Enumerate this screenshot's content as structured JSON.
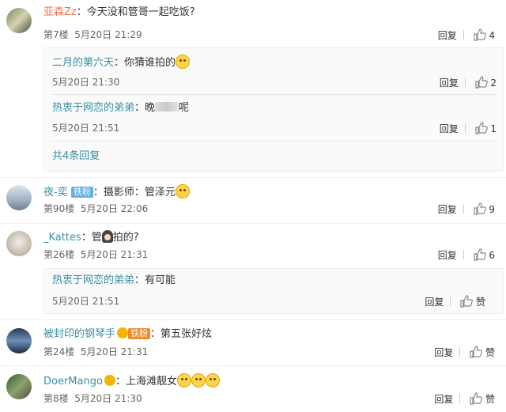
{
  "comments": [
    {
      "user": "亚森Zz",
      "text": "：今天没和管哥一起吃饭?",
      "floor": "第7楼",
      "time": "5月20日 21:29",
      "reply_label": "回复",
      "likes": "4",
      "replies": [
        {
          "user": "二月的第六天",
          "text": "：你猜谁拍的",
          "time": "5月20日 21:30",
          "reply_label": "回复",
          "likes": "2"
        },
        {
          "user": "热衷于网恋的弟弟",
          "text_a": "：晚",
          "text_b": "呢",
          "time": "5月20日 21:51",
          "reply_label": "回复",
          "likes": "1"
        }
      ],
      "more_replies": "共4条回复"
    },
    {
      "user": "夜-奕",
      "badge": "铁粉",
      "text": "：摄影师：管泽元",
      "floor": "第90楼",
      "time": "5月20日 22:06",
      "reply_label": "回复",
      "likes": "9"
    },
    {
      "user": "_Kattes",
      "text_a": "：管",
      "text_b": "拍的?",
      "floor": "第26楼",
      "time": "5月20日 21:31",
      "reply_label": "回复",
      "likes": "6",
      "replies": [
        {
          "user": "热衷于网恋的弟弟",
          "text": "：有可能",
          "time": "5月20日 21:51",
          "reply_label": "回复",
          "likes": "赞"
        }
      ]
    },
    {
      "user": "被封印的钢琴手",
      "badge": "铁粉",
      "text": "：第五张好炫",
      "floor": "第24楼",
      "time": "5月20日 21:31",
      "reply_label": "回复",
      "likes": "赞"
    },
    {
      "user": "DoerMango",
      "text": "：上海滩靓女",
      "floor": "第8楼",
      "time": "5月20日 21:30",
      "reply_label": "回复",
      "likes": "赞"
    }
  ],
  "icons": {
    "thumb": "thumb-up-icon",
    "emoji": "smiley-face-icon"
  },
  "colors": {
    "username": "#eb7350",
    "link": "#3b8ea5",
    "badge": "#5fb0e8"
  }
}
